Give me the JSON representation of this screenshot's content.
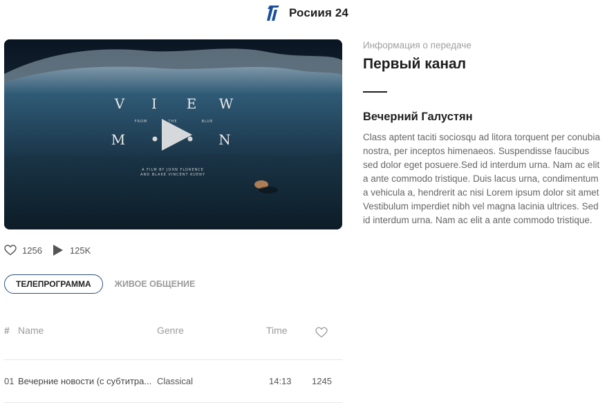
{
  "header": {
    "logo_icon": "channel-one-logo-icon",
    "channel_name": "Росиия 24"
  },
  "player": {
    "state": "paused",
    "play_icon": "play-icon",
    "poster_text": {
      "row1": [
        "V",
        "I",
        "E",
        "W"
      ],
      "from_the_blue": [
        "FROM",
        "THE",
        "BLUE"
      ],
      "row2": [
        "M",
        "N"
      ],
      "credits": [
        "A FILM BY JOHN FLORENCE",
        "AND BLAKE VINCENT KUENY"
      ]
    }
  },
  "stats": {
    "likes": "1256",
    "plays": "125K"
  },
  "tabs": [
    {
      "label": "ТЕЛЕПРОГРАММА",
      "active": true
    },
    {
      "label": "ЖИВОЕ ОБЩЕНИЕ",
      "active": false
    }
  ],
  "table": {
    "columns": {
      "num": "#",
      "name": "Name",
      "genre": "Genre",
      "time": "Time",
      "likes_icon": "heart-icon"
    },
    "rows": [
      {
        "num": "01",
        "name": "Вечерние новости (с субтитра...",
        "genre": "Classical",
        "time": "14:13",
        "likes": "1245"
      }
    ]
  },
  "info": {
    "label": "Информация о передаче",
    "title": "Первый канал",
    "show_title": "Вечерний Галустян",
    "description": "Class aptent taciti sociosqu ad litora torquent per conubia nostra, per inceptos himenaeos. Suspendisse faucibus sed dolor eget posuere.Sed id interdum urna. Nam ac elit a ante commodo tristique. Duis lacus urna, condimentum a vehicula a, hendrerit ac nisi Lorem ipsum dolor sit amet Vestibulum imperdiet nibh vel magna lacinia ultrices. Sed id interdum urna. Nam ac elit a ante commodo tristique."
  },
  "colors": {
    "accent_border": "#2a4f7a",
    "logo_blue": "#1b4f9c",
    "text_dark": "#1e1e1e",
    "text_muted": "#9a9a9a"
  }
}
